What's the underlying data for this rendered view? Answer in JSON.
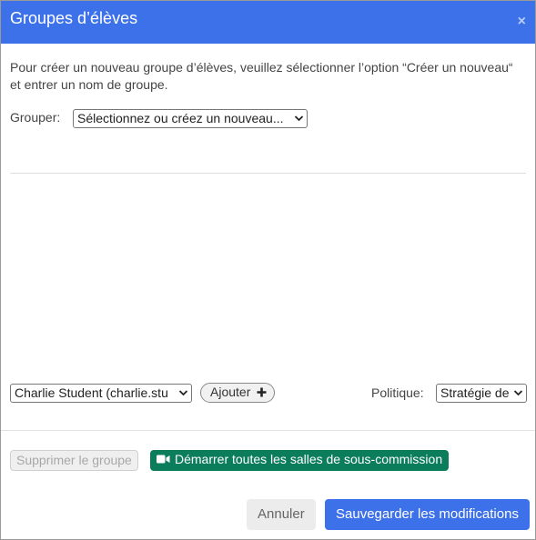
{
  "dialog": {
    "title": "Groupes d’élèves",
    "close_glyph": "×",
    "instructions": "Pour créer un nouveau groupe d’élèves, veuillez sélectionner l’option “Créer un nouveau“ et entrer un nom de groupe."
  },
  "group": {
    "label": "Grouper:",
    "selected": "Sélectionnez ou créez un nouveau..."
  },
  "members": {
    "student_selected": "Charlie Student (charlie.stu",
    "add_label": "Ajouter",
    "add_icon": "plus-icon",
    "policy_label": "Politique:",
    "policy_selected": "Stratégie de"
  },
  "actions": {
    "delete_group": "Supprimer le groupe",
    "start_rooms": "Démarrer toutes les salles de sous-commission",
    "start_icon": "video-camera-icon",
    "cancel": "Annuler",
    "save": "Sauvegarder les modifications"
  },
  "colors": {
    "header": "#3d71e9",
    "primary": "#3d71e9",
    "success": "#0b7d5b"
  }
}
